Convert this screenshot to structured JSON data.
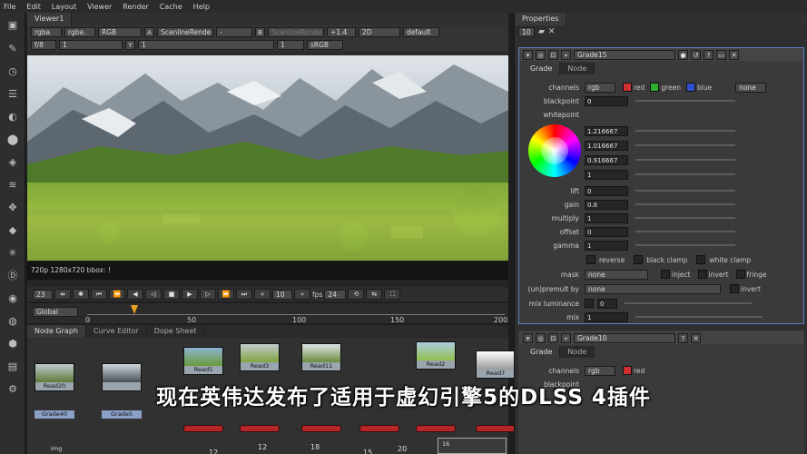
{
  "menu": [
    "File",
    "Edit",
    "Layout",
    "Viewer",
    "Render",
    "Cache",
    "Help"
  ],
  "viewer": {
    "tab": "Viewer1",
    "row1": [
      "rgba",
      "rgba.",
      "RGB",
      "A",
      "ScanlineRende",
      "-",
      "B",
      "ScanlineRende",
      "+1.4",
      "2D",
      "default"
    ],
    "row2": [
      "f/8",
      "1",
      "Y",
      "1",
      "1",
      "sRGB"
    ],
    "info": "720p 1280x720 bbox: !",
    "frame": "23",
    "step": "10",
    "fps_label": "fps",
    "fps": "24",
    "scope": "Global",
    "ticks": [
      "0",
      "50",
      "100",
      "150",
      "200"
    ]
  },
  "nodegraph": {
    "tabs": [
      "Node Graph",
      "Curve Editor",
      "Dope Sheet"
    ],
    "nodes": [
      "Read20",
      "Read5",
      "Read3",
      "Read11",
      "Read2",
      "Read7",
      "Grade40",
      "Grade5"
    ],
    "numbers": [
      "12",
      "12",
      "18",
      "20",
      "15",
      "14",
      "16"
    ],
    "small_label": "img"
  },
  "properties": {
    "title": "Properties",
    "count": "10",
    "panel1": {
      "name": "Grade15",
      "tabs": [
        "Grade",
        "Node"
      ],
      "channels": "rgb",
      "channel_flags": [
        "red",
        "green",
        "blue"
      ],
      "channel_alpha": "none",
      "blackpoint": "0",
      "whitepoint_label": "whitepoint",
      "whitepoint_vals": [
        "1.216667",
        "1.016667",
        "0.916667",
        "1"
      ],
      "lift": "0",
      "gain": "0.8",
      "multiply": "1",
      "offset": "0",
      "gamma": "1",
      "labels": [
        "channels",
        "blackpoint",
        "lift",
        "gain",
        "multiply",
        "offset",
        "gamma"
      ],
      "reverse": "reverse",
      "black_clamp": "black clamp",
      "white_clamp": "white clamp",
      "mask_label": "mask",
      "mask_value": "none",
      "inject": "inject",
      "invert": "invert",
      "fringe": "fringe",
      "unpremult_label": "(un)premult by",
      "unpremult_value": "none",
      "mix_lum_label": "mix luminance",
      "mix_lum": "0",
      "mix_label": "mix",
      "mix": "1",
      "four": "4"
    },
    "panel2": {
      "name": "Grade10",
      "tabs": [
        "Grade",
        "Node"
      ],
      "channels": "rgb",
      "red": "red",
      "blackpoint_label": "blackpoint"
    }
  },
  "subtitle": "现在英伟达发布了适用于虚幻引擎5的DLSS 4插件",
  "colors": {
    "accent": "#5a7fbf",
    "panel": "#3a3a3a",
    "alert": "#b3262a"
  }
}
